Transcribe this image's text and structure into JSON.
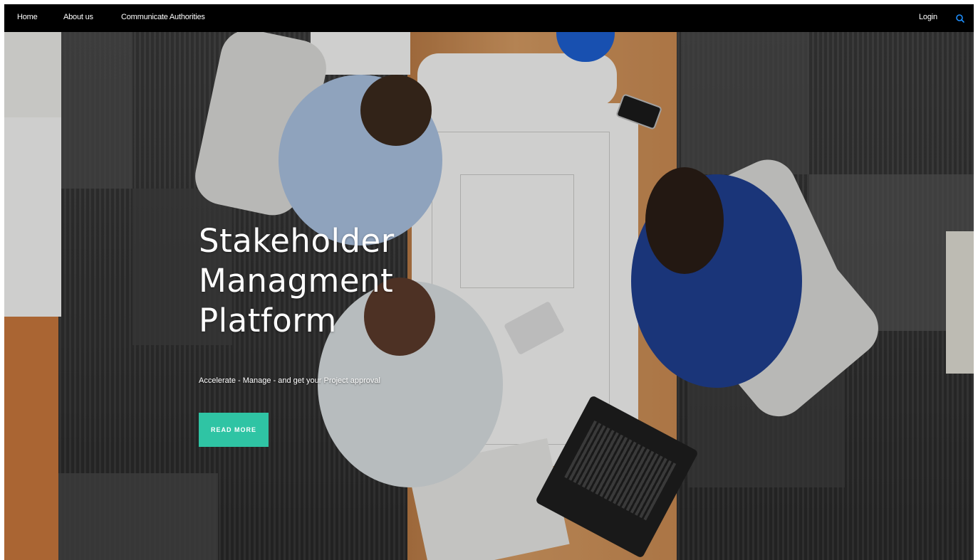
{
  "nav": {
    "items": [
      {
        "label": "Home"
      },
      {
        "label": "About us"
      },
      {
        "label": "Communicate Authorities"
      }
    ],
    "login_label": "Login",
    "search_icon": "search-icon",
    "bg_color": "#000000",
    "search_color": "#1e90ff"
  },
  "hero": {
    "title_line1": "Stakeholder",
    "title_line2": "Managment",
    "title_line3": "Platform",
    "subtitle": "Accelerate - Manage - and get your Project approval",
    "cta_label": "READ MORE",
    "cta_color": "#2fc4a4",
    "background_image": "people-working-over-blueprints-photo"
  }
}
